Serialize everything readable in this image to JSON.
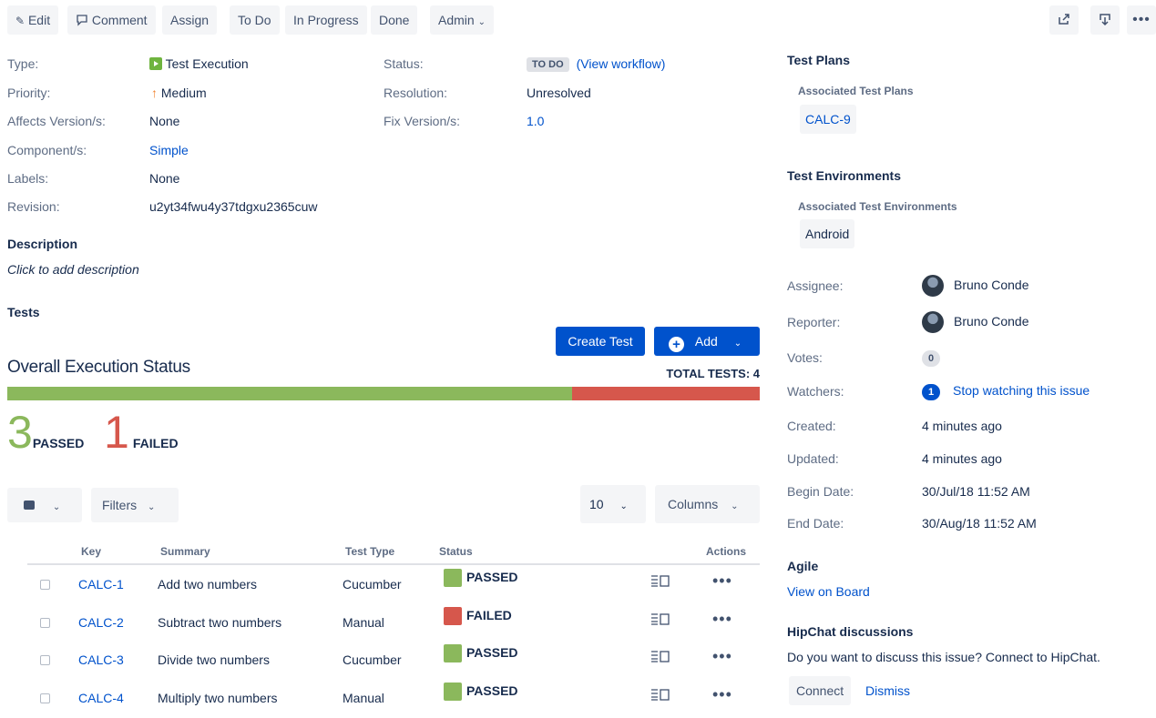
{
  "toolbar": {
    "edit": "Edit",
    "comment": "Comment",
    "assign": "Assign",
    "todo": "To Do",
    "in_progress": "In Progress",
    "done": "Done",
    "admin": "Admin",
    "icons": [
      "share-icon",
      "export-icon",
      "more-icon"
    ]
  },
  "details": {
    "type_label": "Type:",
    "type_value": "Test Execution",
    "priority_label": "Priority:",
    "priority_value": "Medium",
    "affects_label": "Affects Version/s:",
    "affects_value": "None",
    "component_label": "Component/s:",
    "component_value": "Simple",
    "labels_label": "Labels:",
    "labels_value": "None",
    "revision_label": "Revision:",
    "revision_value": "u2yt34fwu4y37tdgxu2365cuw",
    "status_label": "Status:",
    "status_value": "TO DO",
    "workflow_link": "(View workflow)",
    "resolution_label": "Resolution:",
    "resolution_value": "Unresolved",
    "fix_label": "Fix Version/s:",
    "fix_value": "1.0"
  },
  "description": {
    "title": "Description",
    "placeholder": "Click to add description"
  },
  "tests": {
    "title": "Tests",
    "create_button": "Create Test",
    "add_button": "Add",
    "overall_title": "Overall Execution Status",
    "total_label": "TOTAL TESTS: 4",
    "progress": {
      "passed_fraction": 0.75,
      "failed_fraction": 0.25
    },
    "passed_count": "3",
    "passed_label": "PASSED",
    "failed_count": "1",
    "failed_label": "FAILED",
    "filters_label": "Filters",
    "page_size": "10",
    "columns_label": "Columns",
    "headers": {
      "key": "Key",
      "summary": "Summary",
      "type": "Test Type",
      "status": "Status",
      "actions": "Actions"
    },
    "rows": [
      {
        "key": "CALC-1",
        "summary": "Add two numbers",
        "type": "Cucumber",
        "status": "PASSED",
        "color": "#8bb85c"
      },
      {
        "key": "CALC-2",
        "summary": "Subtract two numbers",
        "type": "Manual",
        "status": "FAILED",
        "color": "#d6574c"
      },
      {
        "key": "CALC-3",
        "summary": "Divide two numbers",
        "type": "Cucumber",
        "status": "PASSED",
        "color": "#8bb85c"
      },
      {
        "key": "CALC-4",
        "summary": "Multiply two numbers",
        "type": "Manual",
        "status": "PASSED",
        "color": "#8bb85c"
      }
    ],
    "colors": {
      "passed": "#8bb85c",
      "failed": "#d6574c"
    }
  },
  "sidebar": {
    "test_plans_title": "Test Plans",
    "assoc_plans_label": "Associated Test Plans",
    "plan": "CALC-9",
    "env_title": "Test Environments",
    "assoc_env_label": "Associated Test Environments",
    "env": "Android",
    "assignee_label": "Assignee:",
    "assignee": "Bruno Conde",
    "reporter_label": "Reporter:",
    "reporter": "Bruno Conde",
    "votes_label": "Votes:",
    "votes": "0",
    "watchers_label": "Watchers:",
    "watchers_count": "1",
    "watch_link": "Stop watching this issue",
    "created_label": "Created:",
    "created": "4 minutes ago",
    "updated_label": "Updated:",
    "updated": "4 minutes ago",
    "begin_label": "Begin Date:",
    "begin": "30/Jul/18 11:52 AM",
    "end_label": "End Date:",
    "end": "30/Aug/18 11:52 AM",
    "agile_title": "Agile",
    "agile_link": "View on Board",
    "hipchat_title": "HipChat discussions",
    "hipchat_text": "Do you want to discuss this issue? Connect to HipChat.",
    "connect": "Connect",
    "dismiss": "Dismiss"
  }
}
